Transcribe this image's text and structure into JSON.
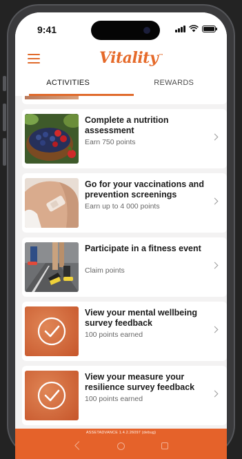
{
  "status_bar": {
    "time": "9:41"
  },
  "header": {
    "logo_text": "Vitality",
    "logo_mark": "™"
  },
  "tabs": [
    {
      "label": "ACTIVITIES",
      "active": true
    },
    {
      "label": "REWARDS",
      "active": false
    }
  ],
  "activities": [
    {
      "title": "Complete a nutrition assessment",
      "subtitle": "Earn 750 points",
      "thumbnail": "berries-bowl-photo"
    },
    {
      "title": "Go for your vaccinations and prevention screenings",
      "subtitle": "Earn up to 4 000 points",
      "thumbnail": "arm-bandage-photo"
    },
    {
      "title": "Participate in a fitness event",
      "subtitle": "Claim points",
      "thumbnail": "runners-legs-photo"
    },
    {
      "title": "View your mental wellbeing survey feedback",
      "subtitle": "100 points earned",
      "thumbnail": "check-circle-icon"
    },
    {
      "title": "View your measure your resilience survey feedback",
      "subtitle": "100 points earned",
      "thumbnail": "check-circle-icon"
    }
  ],
  "footer": {
    "build_text": "ASSETADVANCE 1.4.2.26097 (debug)"
  },
  "colors": {
    "accent": "#e5622a",
    "background": "#f3f2f2",
    "card": "#ffffff"
  }
}
